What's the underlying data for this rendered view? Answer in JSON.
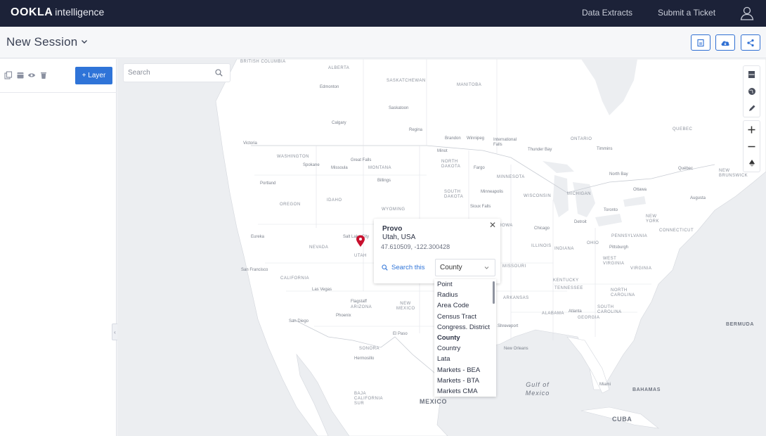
{
  "app": {
    "logo_brand": "OOKLA",
    "logo_suffix": "intelligence",
    "nav": {
      "data_extracts": "Data Extracts",
      "submit_ticket": "Submit a Ticket"
    }
  },
  "session": {
    "title": "New Session",
    "toolbar_icons": [
      "save-icon",
      "cloud-download-icon",
      "share-icon"
    ]
  },
  "left_panel": {
    "tool_icons": [
      "copy-icon",
      "folder-icon",
      "eye-icon",
      "trash-icon"
    ],
    "add_layer_label": "+ Layer"
  },
  "map": {
    "search_placeholder": "Search",
    "controls": [
      "layers-icon",
      "globe-icon",
      "pencil-icon",
      "zoom-in-icon",
      "zoom-out-icon",
      "compass-icon"
    ],
    "labels": {
      "british_columbia": "BRITISH COLUMBIA",
      "alberta": "ALBERTA",
      "saskatchewan": "SASKATCHEWAN",
      "manitoba": "MANITOBA",
      "ontario": "ONTARIO",
      "quebec": "QUEBEC",
      "edmonton": "Edmonton",
      "calgary": "Calgary",
      "saskatoon": "Saskatoon",
      "regina": "Regina",
      "brandon": "Brandon",
      "winnipeg": "Winnipeg",
      "international_falls": "International Falls",
      "thunder_bay": "Thunder Bay",
      "timmins": "Timmins",
      "victoria": "Victoria",
      "washington": "WASHINGTON",
      "spokane": "Spokane",
      "great_falls": "Great Falls",
      "missoula": "Missoula",
      "montana": "MONTANA",
      "minot": "Minot",
      "north_dakota": "NORTH DAKOTA",
      "fargo": "Fargo",
      "minnesota": "MINNESOTA",
      "north_bay": "North Bay",
      "quebec_city": "Québec",
      "new_brunswick": "NEW BRUNSWICK",
      "portland": "Portland",
      "billings": "Billings",
      "south_dakota": "SOUTH DAKOTA",
      "minneapolis": "Minneapolis",
      "wisconsin": "WISCONSIN",
      "michigan": "MICHIGAN",
      "ottawa": "Ottawa",
      "augusta": "Augusta",
      "oregon": "OREGON",
      "idaho": "IDAHO",
      "wyoming": "WYOMING",
      "sioux_falls": "Sioux Falls",
      "iowa": "IOWA",
      "chicago": "Chicago",
      "detroit": "Detroit",
      "toronto": "Toronto",
      "new_york": "NEW YORK",
      "connecticut": "CONNECTICUT",
      "eureka": "Eureka",
      "nevada": "NEVADA",
      "salt_lake_city": "Salt Lake City",
      "utah": "UTAH",
      "illinois": "ILLINOIS",
      "indiana": "INDIANA",
      "ohio": "OHIO",
      "pennsylvania": "PENNSYLVANIA",
      "pittsburgh": "Pittsburgh",
      "san_francisco": "San Francisco",
      "california": "CALIFORNIA",
      "missouri": "MISSOURI",
      "west_virginia": "WEST VIRGINIA",
      "virginia": "VIRGINIA",
      "las_vegas": "Las Vegas",
      "kentucky": "KENTUCKY",
      "tennessee": "TENNESSEE",
      "north_carolina": "NORTH CAROLINA",
      "flagstaff": "Flagstaff",
      "arizona": "ARIZONA",
      "new_mexico": "NEW MEXICO",
      "arkansas": "ARKANSAS",
      "south_carolina": "SOUTH CAROLINA",
      "atlanta": "Atlanta",
      "phoenix": "Phoenix",
      "san_diego": "San Diego",
      "alabama": "ALABAMA",
      "georgia": "GEORGIA",
      "shreveport": "Shreveport",
      "el_paso": "El Paso",
      "bermuda": "BERMUDA",
      "sonora": "SONORA",
      "hermosillo": "Hermosillo",
      "new_orleans": "New Orleans",
      "baja_california_sur": "BAJA CALIFORNIA SUR",
      "miami": "Miami",
      "gulf_of_mexico": "Gulf of\nMexico",
      "bahamas": "BAHAMAS",
      "mexico": "MEXICO",
      "cuba": "CUBA"
    }
  },
  "popup": {
    "place": "Provo",
    "region": "Utah, USA",
    "coords": "47.610509, -122.300428",
    "search_label": "Search this",
    "selected": "County",
    "options": [
      "Point",
      "Radius",
      "Area Code",
      "Census Tract",
      "Congress. District",
      "County",
      "Country",
      "Lata",
      "Markets - BEA",
      "Markets - BTA",
      "Markets CMA"
    ]
  },
  "colors": {
    "nav_bg": "#1c2238",
    "accent": "#2f74d8",
    "pin": "#c8102e",
    "map_bg": "#eef0f3"
  }
}
